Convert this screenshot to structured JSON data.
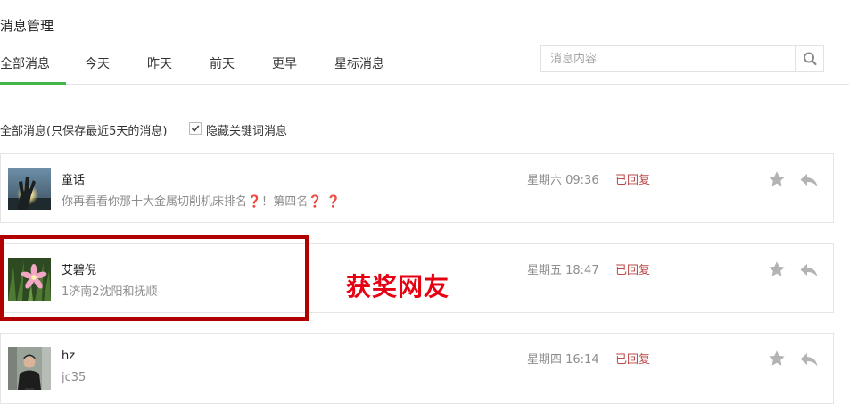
{
  "page": {
    "title": "消息管理"
  },
  "tabs": [
    {
      "label": "全部消息",
      "active": true
    },
    {
      "label": "今天"
    },
    {
      "label": "昨天"
    },
    {
      "label": "前天"
    },
    {
      "label": "更早"
    },
    {
      "label": "星标消息"
    }
  ],
  "search": {
    "placeholder": "消息内容",
    "value": "",
    "icon": "search-icon"
  },
  "filter": {
    "label": "全部消息(只保存最近5天的消息)",
    "checkbox_label": "隐藏关键词消息",
    "checked": true
  },
  "messages": [
    {
      "name": "童话",
      "text_parts": [
        "你再看看你那十大金属切削机床排名",
        "❓",
        "！第四名",
        "❓",
        " ",
        "❓"
      ],
      "time": "星期六 09:36",
      "status": "已回复"
    },
    {
      "name": "艾碧倪",
      "text": "1济南2沈阳和抚顺",
      "time": "星期五 18:47",
      "status": "已回复"
    },
    {
      "name": "hz",
      "text": "jc35",
      "time": "星期四 16:14",
      "status": "已回复"
    }
  ],
  "annotation": {
    "text": "获奖网友",
    "color": "#e60012"
  },
  "colors": {
    "accent": "#44b549",
    "status": "#b94a48",
    "highlight": "#b00000"
  }
}
